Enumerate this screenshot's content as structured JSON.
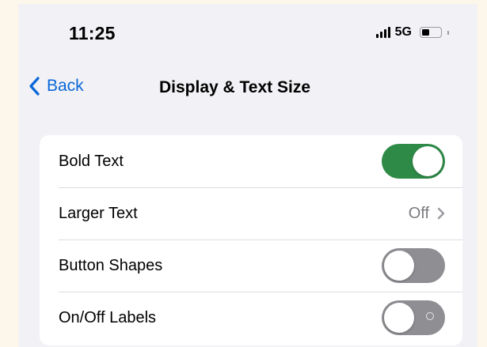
{
  "status_bar": {
    "time": "11:25",
    "network": "5G",
    "battery_level": 0.45
  },
  "nav": {
    "back_label": "Back",
    "title": "Display & Text Size"
  },
  "colors": {
    "accent": "#0a66d8",
    "toggle_on": "#2e8b47",
    "toggle_off": "#8e8e93"
  },
  "settings": [
    {
      "label": "Bold Text",
      "type": "toggle",
      "on": true
    },
    {
      "label": "Larger Text",
      "type": "value",
      "value": "Off",
      "icon": "chevron-right-icon"
    },
    {
      "label": "Button Shapes",
      "type": "toggle",
      "on": false
    },
    {
      "label": "On/Off Labels",
      "type": "toggle",
      "on": false,
      "shows_off_label": true
    }
  ]
}
